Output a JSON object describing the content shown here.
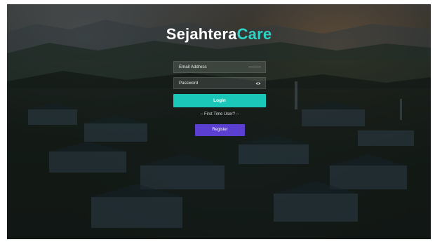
{
  "brand": {
    "part1": "Sejahtera",
    "part2": "Care"
  },
  "login_form": {
    "email_placeholder": "Email Address",
    "password_placeholder": "Password",
    "password_toggle_icon": "eye-icon",
    "login_label": "Login",
    "first_time_text": "-- First Time User? --",
    "register_label": "Register"
  },
  "colors": {
    "accent": "#2ed3c6",
    "login_button": "#1bc7b9",
    "register_button": "#5a3fd1"
  }
}
